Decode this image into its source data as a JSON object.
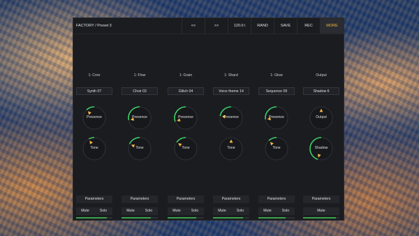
{
  "header": {
    "preset": "FACTORY / Preset 3",
    "buttons": [
      {
        "id": "prev",
        "label": "<<"
      },
      {
        "id": "next",
        "label": ">>"
      },
      {
        "id": "tempo",
        "label": "120.0 i"
      },
      {
        "id": "rand",
        "label": "RAND"
      },
      {
        "id": "save",
        "label": "SAVE"
      },
      {
        "id": "rec",
        "label": "REC"
      },
      {
        "id": "more",
        "label": "MORE"
      }
    ]
  },
  "colors": {
    "accent": "#f2b844",
    "knob_arc": "#3ecf6a",
    "meter": "#3aa34a",
    "panel": "#1a1c20"
  },
  "strips": [
    {
      "name": "1: Core",
      "slot": "Synth 07",
      "knob1": "Presence",
      "knob1_value": 0.12,
      "knob2": "Tone",
      "knob2_value": 0.08,
      "params": "Parameters",
      "mute": "Mute",
      "solo": "Solo",
      "meter": 0.85
    },
    {
      "name": "1: Flow",
      "slot": "Choir 03",
      "knob1": "Presence",
      "knob1_value": 0.28,
      "knob2": "Tone",
      "knob2_value": 0.18,
      "params": "Parameters",
      "mute": "Mute",
      "solo": "Solo",
      "meter": 0.8
    },
    {
      "name": "1: Grain",
      "slot": "Glitch 04",
      "knob1": "Presence",
      "knob1_value": 0.3,
      "knob2": "Tone",
      "knob2_value": 0.15,
      "params": "Parameters",
      "mute": "Mute",
      "solo": "Solo",
      "meter": 0.78
    },
    {
      "name": "1: Shard",
      "slot": "Voice theme 14",
      "knob1": "Presence",
      "knob1_value": 0.22,
      "knob2": "Tone",
      "knob2_value": 0.0,
      "params": "Parameters",
      "mute": "Mute",
      "solo": "Solo",
      "meter": 0.82
    },
    {
      "name": "1: Glow",
      "slot": "Sequence 09",
      "knob1": "Presence",
      "knob1_value": 0.27,
      "knob2": "Tone",
      "knob2_value": 0.12,
      "params": "Parameters",
      "mute": "Mute",
      "solo": "Solo",
      "meter": 0.75
    },
    {
      "name": "Output",
      "slot": "Shadow 6",
      "knob1": "Output",
      "knob1_value": 0.0,
      "knob2": "Shadow",
      "knob2_value": 0.45,
      "params": "Parameters",
      "mute": "Mute",
      "solo": "",
      "meter": 0.9
    }
  ]
}
